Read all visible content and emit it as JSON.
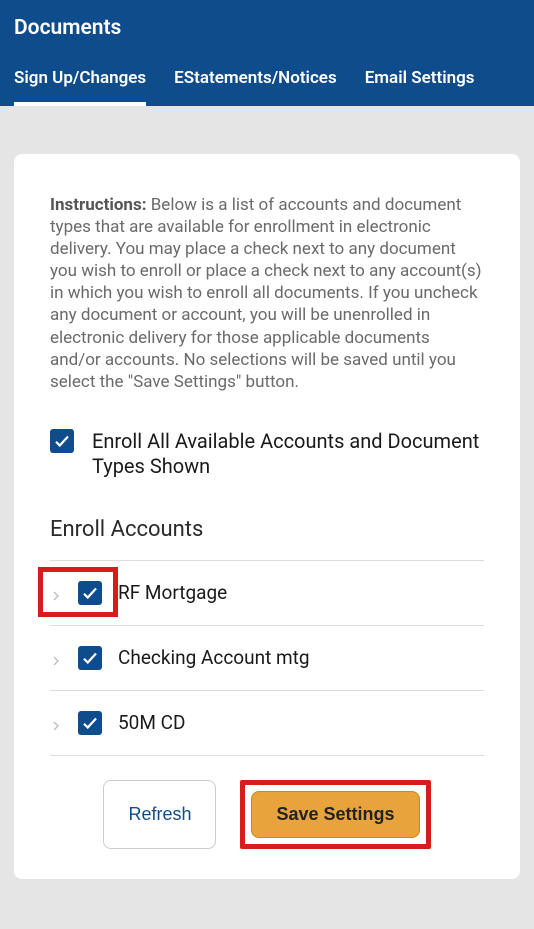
{
  "header": {
    "title": "Documents",
    "tabs": [
      {
        "label": "Sign Up/Changes",
        "active": true
      },
      {
        "label": "EStatements/Notices",
        "active": false
      },
      {
        "label": "Email Settings",
        "active": false
      }
    ]
  },
  "instructions": {
    "label": "Instructions:",
    "text": " Below is a list of accounts and document types that are available for enrollment in electronic delivery. You may place a check next to any document you wish to enroll or place a check next to any account(s) in which you wish to enroll all documents. If you uncheck any document or account, you will be unenrolled in electronic delivery for those applicable documents and/or accounts. No selections will be saved until you select the \"Save Settings\" button."
  },
  "enroll_all": {
    "checked": true,
    "label": "Enroll All Available Accounts and Document Types Shown"
  },
  "section_title": "Enroll Accounts",
  "accounts": [
    {
      "label": "RF Mortgage",
      "checked": true,
      "highlighted": true
    },
    {
      "label": "Checking Account mtg",
      "checked": true,
      "highlighted": false
    },
    {
      "label": "50M CD",
      "checked": true,
      "highlighted": false
    }
  ],
  "actions": {
    "refresh": "Refresh",
    "save": "Save Settings",
    "save_highlighted": true
  }
}
